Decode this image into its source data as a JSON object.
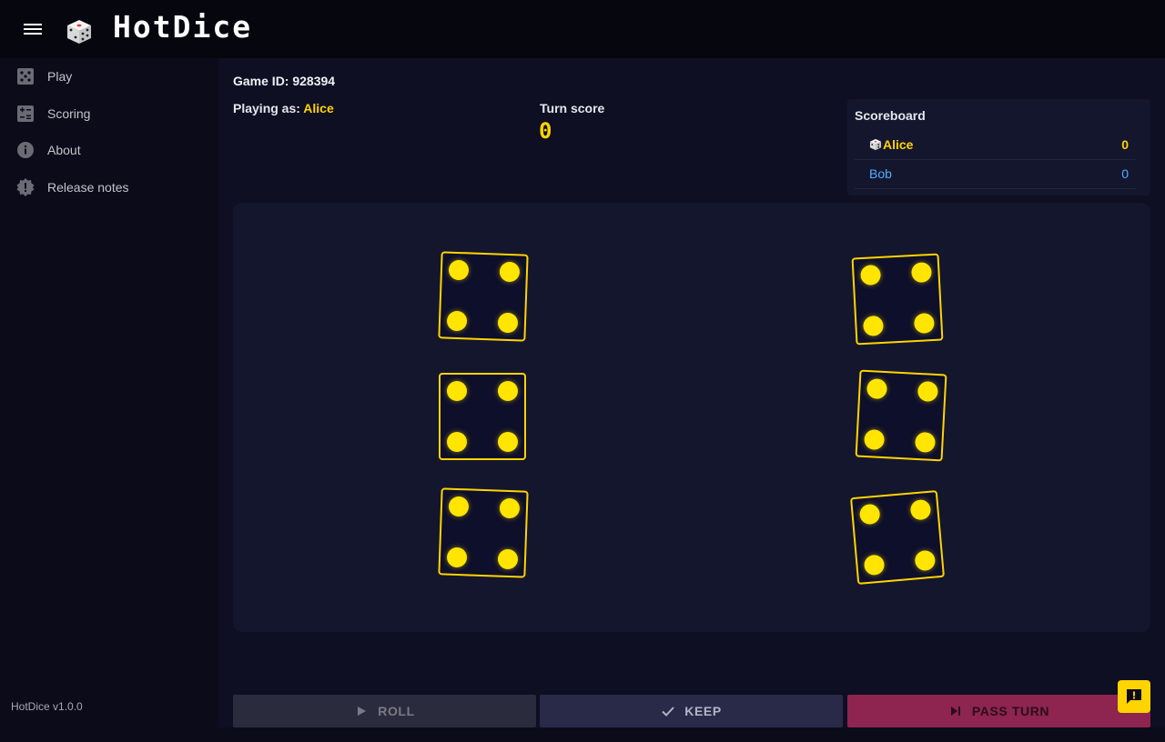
{
  "app": {
    "title": "HotDice",
    "version": "HotDice v1.0.0"
  },
  "sidebar": {
    "items": [
      {
        "label": "Play",
        "icon": "dice-icon"
      },
      {
        "label": "Scoring",
        "icon": "calculator-icon"
      },
      {
        "label": "About",
        "icon": "info-icon"
      },
      {
        "label": "Release notes",
        "icon": "alert-badge-icon"
      }
    ]
  },
  "game": {
    "id_label": "Game ID:",
    "id_value": "928394",
    "playing_label": "Playing as:",
    "player_name": "Alice",
    "turn_score_label": "Turn score",
    "turn_score_value": "0"
  },
  "scoreboard": {
    "title": "Scoreboard",
    "players": [
      {
        "name": "Alice",
        "score": "0",
        "active": true
      },
      {
        "name": "Bob",
        "score": "0",
        "active": false
      }
    ]
  },
  "dice": [
    {
      "value": 4,
      "rotation": 2
    },
    {
      "value": 4,
      "rotation": -3
    },
    {
      "value": 4,
      "rotation": 0
    },
    {
      "value": 4,
      "rotation": 3
    },
    {
      "value": 4,
      "rotation": 2
    },
    {
      "value": 4,
      "rotation": -5
    }
  ],
  "actions": {
    "roll": "ROLL",
    "keep": "KEEP",
    "pass": "PASS TURN"
  },
  "colors": {
    "accent": "#ffd400",
    "player_other": "#4fb0ff",
    "pass_button": "#8e2450"
  }
}
